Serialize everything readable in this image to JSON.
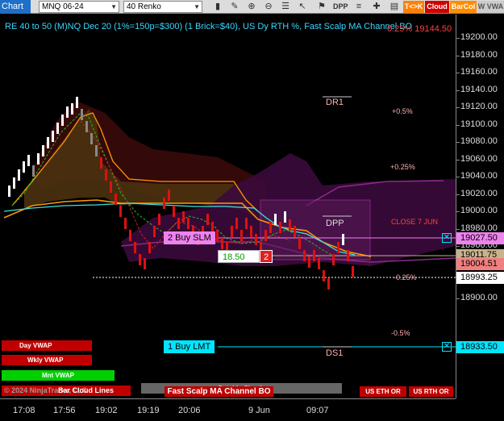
{
  "toolbar": {
    "chart_tab": "Chart",
    "instrument": "MNQ 06-24",
    "bar_type": "40 Renko",
    "icons": [
      "bar-style-icon",
      "draw-icon",
      "zoom-in-icon",
      "zoom-out-icon",
      "properties-icon",
      "cursor-icon",
      "strategy-icon",
      "dom-icon",
      "stack-icon"
    ],
    "buttons": {
      "tk": "T<>K",
      "cloud": "Cloud",
      "barcol": "BarCol",
      "vwap": "W VWA"
    },
    "colors": {
      "tk": "#ff8000",
      "cloud": "#d00000",
      "barcol": "#ff8c00",
      "vwap": "#cccccc"
    }
  },
  "title": "RE 40 to 50 (M)NQ Dec 20 (1%=150p=$300) (1 Brick=$40), US Dy RTH %, Fast Scalp MA Channel BO",
  "title_overlay": "0.25% 19144.50",
  "yaxis": {
    "ticks": [
      "19200.00",
      "19180.00",
      "19160.00",
      "19140.00",
      "19120.00",
      "19100.00",
      "19080.00",
      "19060.00",
      "19040.00",
      "19020.00",
      "19000.00",
      "18980.00",
      "18960.00",
      "18940.00",
      "18920.00",
      "18900.00"
    ],
    "price_tags": [
      {
        "label": "19027.50",
        "bg": "#ee82ee"
      },
      {
        "label": "19011.75",
        "bg": "#c8b48c"
      },
      {
        "label": "19004.51",
        "bg": "#f08080"
      },
      {
        "label": "18993.25",
        "bg": "#ffffff"
      },
      {
        "label": "18933.50",
        "bg": "#00e5ff"
      }
    ]
  },
  "xaxis": {
    "ticks": [
      "17:08",
      "17:56",
      "19:02",
      "19:19",
      "20:06",
      "9 Jun",
      "09:07"
    ]
  },
  "levels": {
    "dr1": "DR1",
    "dpp": "DPP",
    "ds1": "DS1",
    "p05": "+0.5%",
    "p025": "+0.25%",
    "close": "CLOSE 7 JUN",
    "m025": "-0.25%",
    "m05": "-0.5%"
  },
  "orders": {
    "buy_slm": "2 Buy SLM",
    "buy_lmt": "1 Buy LMT",
    "entry_price": "18.50",
    "entry_qty": "2"
  },
  "panel": {
    "day_vwap": "Day VWAP",
    "wkly_vwap": "Wkly VWAP",
    "mnt_vwap": "Mnt VWAP",
    "outside_clouds": "Outside Clouds",
    "fast_scalp": "Fast Scalp MA Channel BO",
    "us_eth_or": "US ETH OR",
    "us_rth_or": "US RTH OR",
    "copyright": "© 2024 NinjaTrader, LLC",
    "cloud_lines": "Bar Cloud Lines"
  }
}
